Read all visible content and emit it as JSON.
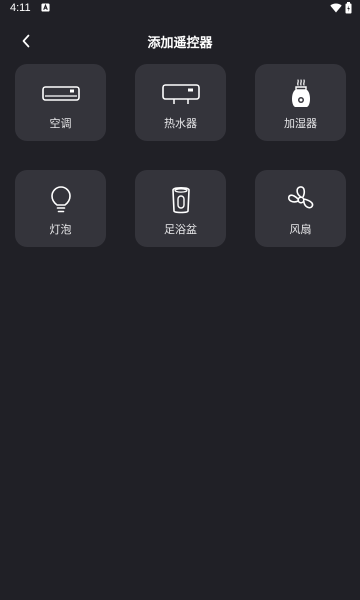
{
  "status_bar": {
    "time": "4:11"
  },
  "header": {
    "title": "添加遥控器"
  },
  "devices": [
    {
      "label": "空调",
      "icon": "air-conditioner-icon"
    },
    {
      "label": "热水器",
      "icon": "water-heater-icon"
    },
    {
      "label": "加湿器",
      "icon": "humidifier-icon"
    },
    {
      "label": "灯泡",
      "icon": "light-bulb-icon"
    },
    {
      "label": "足浴盆",
      "icon": "foot-bath-icon"
    },
    {
      "label": "风扇",
      "icon": "fan-icon"
    }
  ],
  "colors": {
    "background": "#202026",
    "card": "#34343b",
    "text": "#ffffff"
  }
}
